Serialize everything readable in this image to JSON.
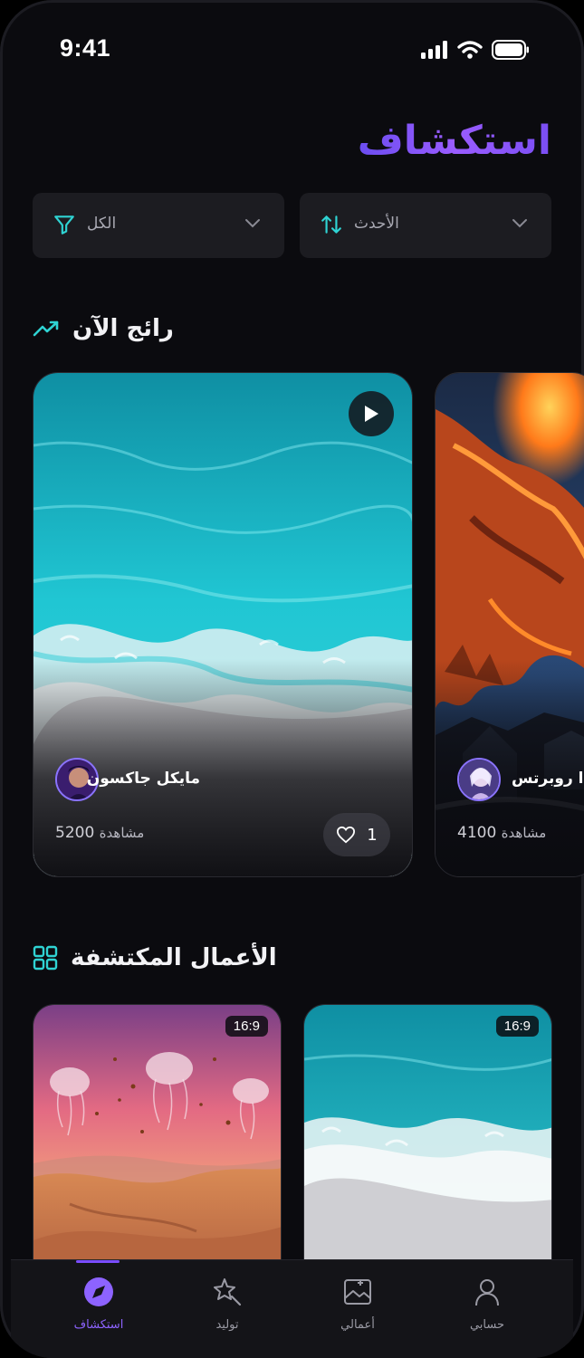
{
  "status_bar": {
    "time": "9:41"
  },
  "page_title": "استكشاف",
  "filters": {
    "category": {
      "label": "الكل"
    },
    "sort": {
      "label": "الأحدث"
    }
  },
  "trending": {
    "title": "رائج الآن",
    "cards": [
      {
        "author": "مايكل جاكسون",
        "views_number": "5200",
        "views_word": "مشاهدة",
        "likes": "1"
      },
      {
        "author": "ا روبرتس",
        "views_number": "4100",
        "views_word": "مشاهدة"
      }
    ]
  },
  "explored": {
    "title": "الأعمال المكتشفة",
    "cards": [
      {
        "ratio": "16:9"
      },
      {
        "ratio": "16:9"
      }
    ]
  },
  "nav": {
    "explore": "استكشاف",
    "generate": "توليد",
    "my_works": "أعمالي",
    "account": "حسابي"
  },
  "colors": {
    "accent": "#7b4dff",
    "teal": "#2fd3d3",
    "background": "#0b0b0f"
  }
}
